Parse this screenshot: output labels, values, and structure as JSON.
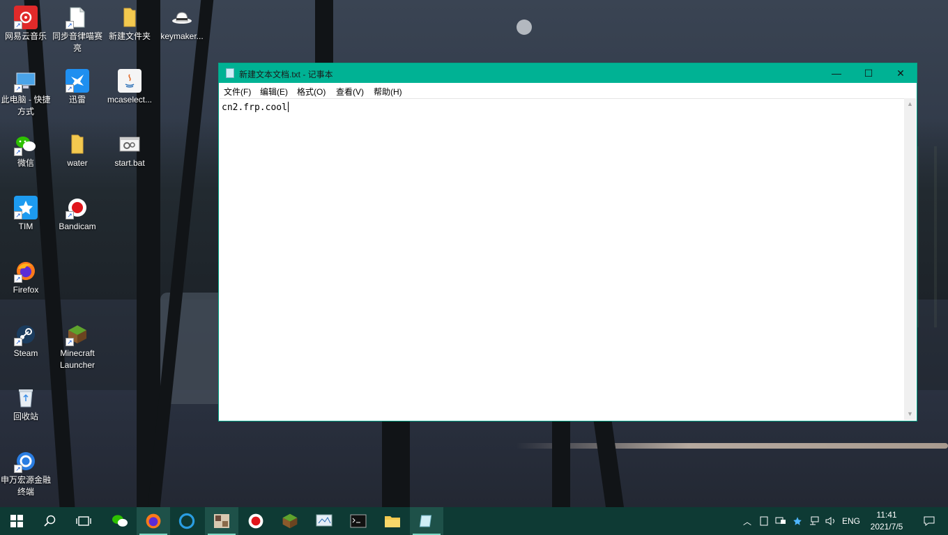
{
  "desktop": {
    "icons": [
      {
        "label": "网易云音乐",
        "icon": "netease-music-icon"
      },
      {
        "label": "同步音律喵赛亮",
        "icon": "file-icon"
      },
      {
        "label": "新建文件夹",
        "icon": "folder-icon"
      },
      {
        "label": "keymaker...",
        "icon": "hat-icon"
      },
      {
        "label": "此电脑 - 快捷方式",
        "icon": "computer-icon"
      },
      {
        "label": "迅雷",
        "icon": "thunder-icon"
      },
      {
        "label": "mcaselect...",
        "icon": "java-icon"
      },
      {
        "label": "微信",
        "icon": "wechat-icon"
      },
      {
        "label": "water",
        "icon": "folder-icon"
      },
      {
        "label": "start.bat",
        "icon": "batch-file-icon"
      },
      {
        "label": "TIM",
        "icon": "tim-icon"
      },
      {
        "label": "Bandicam",
        "icon": "record-icon"
      },
      {
        "label": "Firefox",
        "icon": "firefox-icon"
      },
      {
        "label": "Steam",
        "icon": "steam-icon"
      },
      {
        "label": "Minecraft Launcher",
        "icon": "minecraft-icon"
      },
      {
        "label": "回收站",
        "icon": "recycle-bin-icon"
      },
      {
        "label": "申万宏源金融终端",
        "icon": "finance-terminal-icon"
      }
    ]
  },
  "notepad": {
    "title": "新建文本文档.txt - 记事本",
    "menu": [
      "文件(F)",
      "编辑(E)",
      "格式(O)",
      "查看(V)",
      "帮助(H)"
    ],
    "content": "cn2.frp.cool",
    "buttons": {
      "minimize": "—",
      "maximize": "☐",
      "close": "✕"
    }
  },
  "taskbar": {
    "apps": [
      "start",
      "search",
      "task-view",
      "wechat",
      "firefox",
      "edge-like",
      "photos",
      "bandicam",
      "minecraft",
      "control",
      "terminal",
      "file-explorer",
      "notepad"
    ],
    "tray": {
      "language": "ENG",
      "time": "11:41",
      "date": "2021/7/5"
    }
  },
  "colors": {
    "accent": "#00b294",
    "taskbar": "#0e3a34"
  }
}
